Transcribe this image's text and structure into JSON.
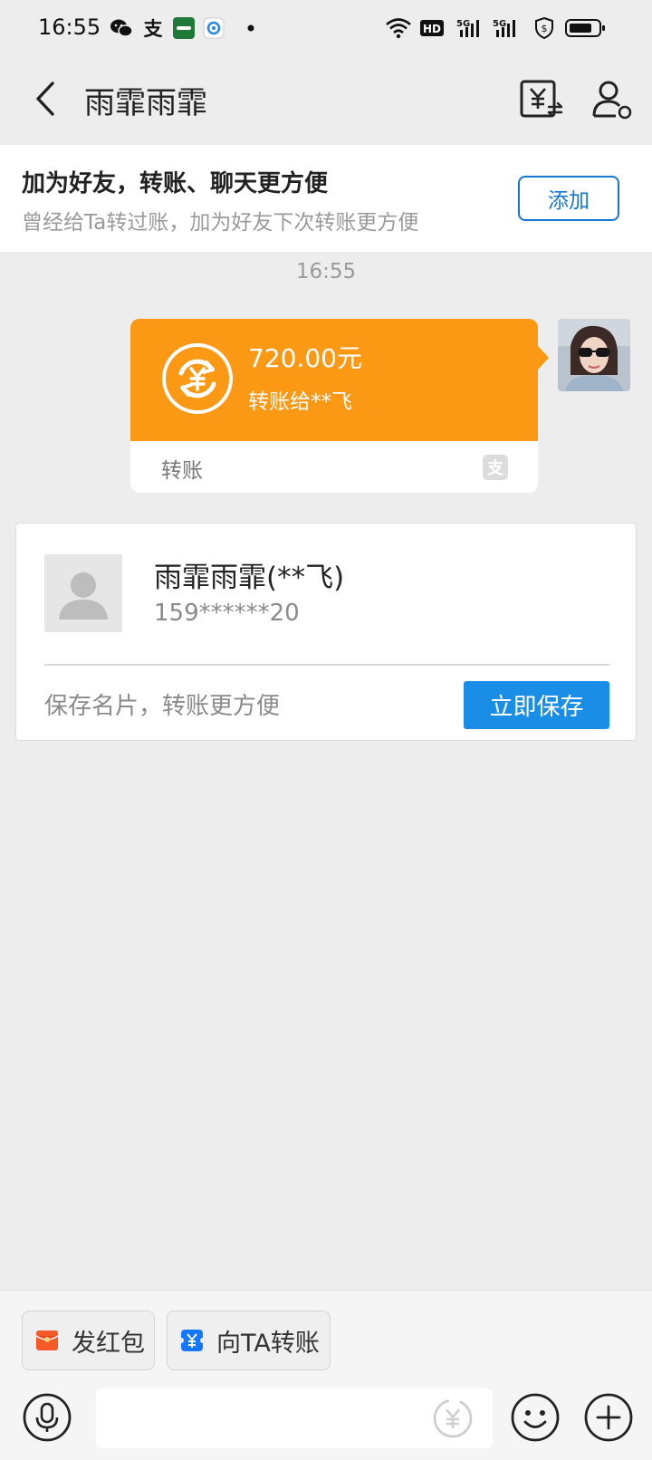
{
  "status_bar": {
    "time": "16:55",
    "icons": [
      "wechat-icon",
      "alipay-icon",
      "app-icon",
      "target-icon",
      "dot-icon",
      "wifi-icon",
      "hd-icon",
      "signal-5g-icon",
      "signal-5g-icon",
      "shield-icon",
      "battery-icon"
    ],
    "hd_label": "HD",
    "net_label_1": "5G",
    "net_label_2": "5G"
  },
  "nav": {
    "title": "雨霏雨霏",
    "back_icon": "chevron-left-icon",
    "transfer_icon": "yuan-transfer-icon",
    "profile_icon": "person-settings-icon"
  },
  "banner": {
    "title": "加为好友，转账、聊天更方便",
    "subtitle": "曾经给Ta转过账，加为好友下次转账更方便",
    "add_button": "添加"
  },
  "chat": {
    "timestamp": "16:55",
    "transfer": {
      "amount": "720.00元",
      "to": "转账给**飞",
      "label": "转账",
      "accent": "#fb9814"
    }
  },
  "card": {
    "name": "雨霏雨霏(**飞)",
    "phone": "159******20",
    "hint": "保存名片，转账更方便",
    "save_button": "立即保存"
  },
  "bottom": {
    "red_packet": "发红包",
    "transfer": "向TA转账",
    "input_placeholder": "",
    "icons": [
      "microphone-icon",
      "yuan-icon",
      "emoji-icon",
      "plus-icon"
    ]
  },
  "colors": {
    "accent_orange": "#fb9814",
    "primary_blue": "#1a8de7",
    "link_blue": "#1677d2",
    "red_packet": "#f45a28"
  }
}
